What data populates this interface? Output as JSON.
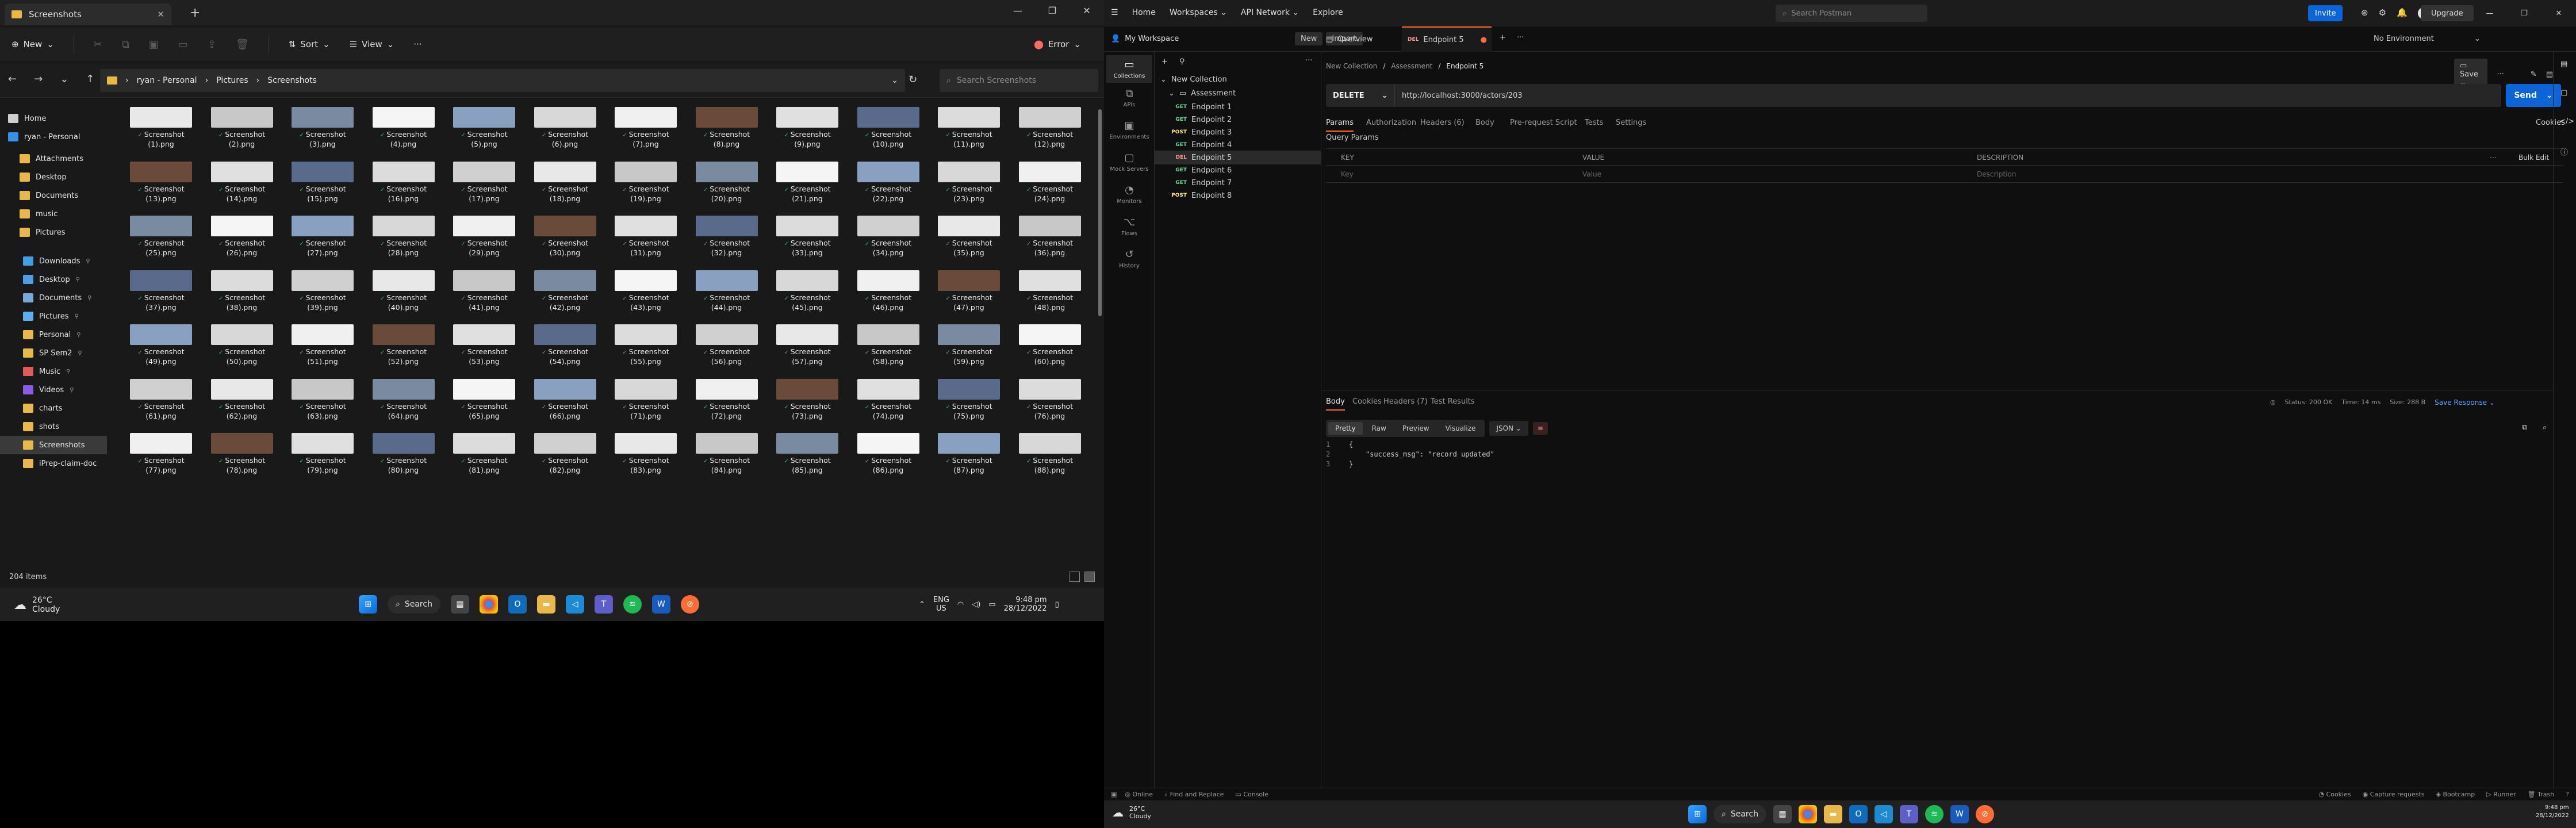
{
  "explorer": {
    "tab_title": "Screenshots",
    "cmd": {
      "new": "New",
      "sort": "Sort",
      "view": "View",
      "more": "···",
      "error": "Error"
    },
    "path": [
      "ryan - Personal",
      "Pictures",
      "Screenshots"
    ],
    "search_placeholder": "Search Screenshots",
    "status": "204 items",
    "sidebar": [
      {
        "label": "Home",
        "icon": "home-icon"
      },
      {
        "label": "ryan - Personal",
        "icon": "cloud-icon"
      },
      {
        "label": "Attachments",
        "icon": "folder-icon"
      },
      {
        "label": "Desktop",
        "icon": "folder-icon"
      },
      {
        "label": "Documents",
        "icon": "folder-icon"
      },
      {
        "label": "music",
        "icon": "folder-icon"
      },
      {
        "label": "Pictures",
        "icon": "folder-icon"
      },
      {
        "label": "Downloads",
        "icon": "download-icon"
      },
      {
        "label": "Desktop",
        "icon": "desktop-icon"
      },
      {
        "label": "Documents",
        "icon": "documents-icon"
      },
      {
        "label": "Pictures",
        "icon": "pictures-icon"
      },
      {
        "label": "Personal",
        "icon": "folder-icon"
      },
      {
        "label": "SP Sem2",
        "icon": "folder-icon"
      },
      {
        "label": "Music",
        "icon": "music-icon"
      },
      {
        "label": "Videos",
        "icon": "video-icon"
      },
      {
        "label": "charts",
        "icon": "folder-icon"
      },
      {
        "label": "shots",
        "icon": "folder-icon"
      },
      {
        "label": "Screenshots",
        "icon": "folder-icon"
      },
      {
        "label": "iPrep-claim-doc",
        "icon": "folder-icon"
      }
    ],
    "files": [
      "Screenshot (1).png",
      "Screenshot (2).png",
      "Screenshot (3).png",
      "Screenshot (4).png",
      "Screenshot (5).png",
      "Screenshot (6).png",
      "Screenshot (7).png",
      "Screenshot (8).png",
      "Screenshot (9).png",
      "Screenshot (10).png",
      "Screenshot (11).png",
      "Screenshot (12).png",
      "Screenshot (13).png",
      "Screenshot (14).png",
      "Screenshot (15).png",
      "Screenshot (16).png",
      "Screenshot (17).png",
      "Screenshot (18).png",
      "Screenshot (19).png",
      "Screenshot (20).png",
      "Screenshot (21).png",
      "Screenshot (22).png",
      "Screenshot (23).png",
      "Screenshot (24).png",
      "Screenshot (25).png",
      "Screenshot (26).png",
      "Screenshot (27).png",
      "Screenshot (28).png",
      "Screenshot (29).png",
      "Screenshot (30).png",
      "Screenshot (31).png",
      "Screenshot (32).png",
      "Screenshot (33).png",
      "Screenshot (34).png",
      "Screenshot (35).png",
      "Screenshot (36).png",
      "Screenshot (37).png",
      "Screenshot (38).png",
      "Screenshot (39).png",
      "Screenshot (40).png",
      "Screenshot (41).png",
      "Screenshot (42).png",
      "Screenshot (43).png",
      "Screenshot (44).png",
      "Screenshot (45).png",
      "Screenshot (46).png",
      "Screenshot (47).png",
      "Screenshot (48).png",
      "Screenshot (49).png",
      "Screenshot (50).png",
      "Screenshot (51).png",
      "Screenshot (52).png",
      "Screenshot (53).png",
      "Screenshot (54).png",
      "Screenshot (55).png",
      "Screenshot (56).png",
      "Screenshot (57).png",
      "Screenshot (58).png",
      "Screenshot (59).png",
      "Screenshot (60).png",
      "Screenshot (61).png",
      "Screenshot (62).png",
      "Screenshot (63).png",
      "Screenshot (64).png",
      "Screenshot (65).png",
      "Screenshot (66).png",
      "Screenshot (71).png",
      "Screenshot (72).png",
      "Screenshot (73).png",
      "Screenshot (74).png",
      "Screenshot (75).png",
      "Screenshot (76).png",
      "Screenshot (77).png",
      "Screenshot (78).png",
      "Screenshot (79).png",
      "Screenshot (80).png",
      "Screenshot (81).png",
      "Screenshot (82).png",
      "Screenshot (83).png",
      "Screenshot (84).png",
      "Screenshot (85).png",
      "Screenshot (86).png",
      "Screenshot (87).png",
      "Screenshot (88).png"
    ],
    "thumb_colors": [
      "#e8e8e8",
      "#6a4a3a",
      "#7a8aa0",
      "#5a6a8a",
      "#8aa0c0",
      "#d0d0d0",
      "#f0f0f0",
      "#c8c8c8",
      "#e0e0e0",
      "#f5f5f5",
      "#dcdcdc",
      "#d8d8d8"
    ]
  },
  "postman": {
    "nav": [
      "Home",
      "Workspaces",
      "API Network",
      "Explore"
    ],
    "search": "Search Postman",
    "invite": "Invite",
    "upgrade": "Upgrade",
    "workspace": "My Workspace",
    "new": "New",
    "import": "Import",
    "tabs": [
      "Overview",
      "Endpoint 5"
    ],
    "environment": "No Environment",
    "rail": [
      "Collections",
      "APIs",
      "Environments",
      "Mock Servers",
      "Monitors",
      "Flows",
      "History"
    ],
    "collection": "New Collection",
    "folder": "Assessment",
    "endpoints": [
      {
        "method": "GET",
        "name": "Endpoint 1",
        "color": "#6bdd9a"
      },
      {
        "method": "GET",
        "name": "Endpoint 2",
        "color": "#6bdd9a"
      },
      {
        "method": "POST",
        "name": "Endpoint 3",
        "color": "#ffe47e"
      },
      {
        "method": "GET",
        "name": "Endpoint 4",
        "color": "#6bdd9a"
      },
      {
        "method": "DEL",
        "name": "Endpoint 5",
        "color": "#f79a8e"
      },
      {
        "method": "GET",
        "name": "Endpoint 6",
        "color": "#6bdd9a"
      },
      {
        "method": "GET",
        "name": "Endpoint 7",
        "color": "#6bdd9a"
      },
      {
        "method": "POST",
        "name": "Endpoint 8",
        "color": "#ffe47e"
      }
    ],
    "breadcrumb": [
      "New Collection",
      "Assessment",
      "Endpoint 5"
    ],
    "save": "Save",
    "method": "DELETE",
    "url": "http://localhost:3000/actors/203",
    "send": "Send",
    "req_tabs": [
      "Params",
      "Authorization",
      "Headers (6)",
      "Body",
      "Pre-request Script",
      "Tests",
      "Settings"
    ],
    "cookies": "Cookies",
    "query_params": "Query Params",
    "columns": [
      "KEY",
      "VALUE",
      "DESCRIPTION"
    ],
    "bulk_edit": "Bulk Edit",
    "placeholders": [
      "Key",
      "Value",
      "Description"
    ],
    "res_tabs": [
      "Body",
      "Cookies",
      "Headers (7)",
      "Test Results"
    ],
    "res_status": "Status: 200 OK",
    "res_time": "Time: 14 ms",
    "res_size": "Size: 288 B",
    "save_response": "Save Response",
    "view_modes": [
      "Pretty",
      "Raw",
      "Preview",
      "Visualize"
    ],
    "format": "JSON",
    "code": [
      "{",
      "    \"success_msg\": \"record updated\"",
      "}"
    ],
    "statusbar": [
      "Online",
      "Find and Replace",
      "Console",
      "Cookies",
      "Capture requests",
      "Bootcamp",
      "Runner",
      "Trash"
    ]
  },
  "taskbar_left": {
    "temp": "26°C",
    "cond": "Cloudy",
    "search": "Search",
    "lang": "ENG",
    "region": "US",
    "time": "9:48 pm",
    "date": "28/12/2022"
  },
  "taskbar_right": {
    "temp": "26°C",
    "cond": "Cloudy",
    "search": "Search",
    "time": "9:48 pm",
    "date": "28/12/2022"
  }
}
